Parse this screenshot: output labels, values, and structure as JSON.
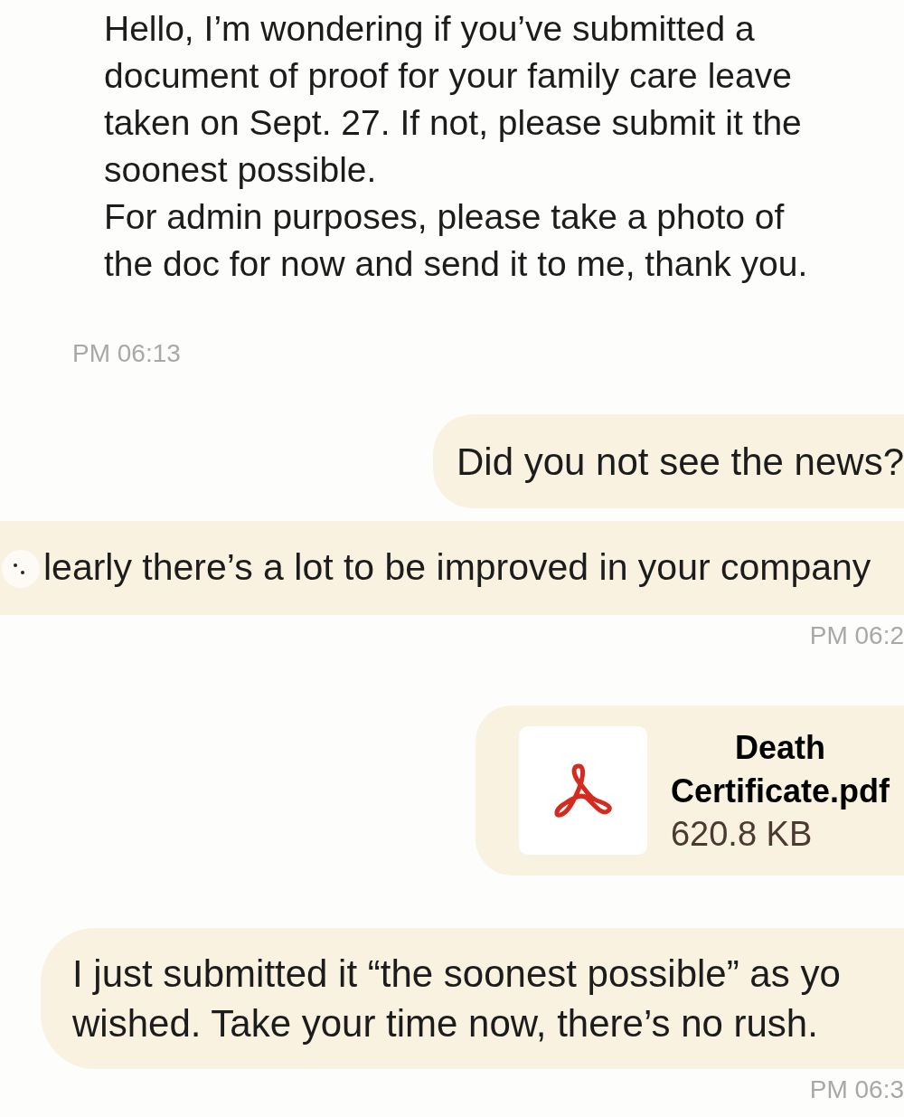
{
  "messages": [
    {
      "kind": "incoming",
      "lines": [
        "Hello, I’m wondering if you’ve submitted a",
        "document of proof for your family care leave",
        "taken on Sept. 27. If not, please submit it the",
        "soonest possible.",
        "For admin purposes, please take a photo of",
        "the doc for now and send it to me,  thank you."
      ]
    },
    {
      "kind": "time_left",
      "text": "PM 06:13"
    },
    {
      "kind": "outgoing",
      "lines": [
        "Did you not see the news?"
      ]
    },
    {
      "kind": "outgoing_wide",
      "lines": [
        "learly there’s a lot to be improved in your company"
      ]
    },
    {
      "kind": "time_right",
      "text": "PM 06:2"
    },
    {
      "kind": "file",
      "name": "Death",
      "name2": "Certificate.pdf",
      "size": "620.8 KB"
    },
    {
      "kind": "outgoing_left",
      "lines": [
        "I just submitted it “the soonest possible” as yo",
        "wished. Take your time now, there’s no rush."
      ]
    },
    {
      "kind": "time_right",
      "text": "PM 06:3"
    }
  ]
}
